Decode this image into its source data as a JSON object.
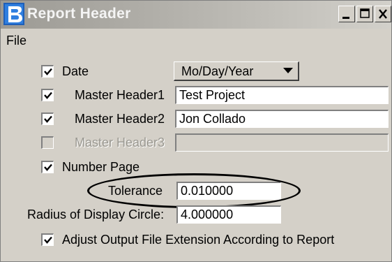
{
  "window": {
    "title": "Report Header",
    "app_icon": "bentley-b-icon",
    "controls": [
      "minimize-icon",
      "maximize-icon",
      "close-icon"
    ]
  },
  "menu": {
    "file": "File"
  },
  "date": {
    "label": "Date",
    "checked": true,
    "format": "Mo/Day/Year"
  },
  "headers": [
    {
      "label": "Master Header1",
      "checked": true,
      "enabled": true,
      "value": "Test Project"
    },
    {
      "label": "Master Header2",
      "checked": true,
      "enabled": true,
      "value": "Jon Collado"
    },
    {
      "label": "Master Header3",
      "checked": false,
      "enabled": false,
      "value": ""
    }
  ],
  "number_page": {
    "label": "Number Page",
    "checked": true
  },
  "tolerance": {
    "label": "Tolerance",
    "value": "0.010000"
  },
  "radius": {
    "label": "Radius of Display Circle:",
    "value": "4.000000"
  },
  "adjust_ext": {
    "label": "Adjust Output File Extension According to Report",
    "checked": true
  },
  "colors": {
    "window_bg": "#d4d0c8",
    "title_text": "#f4f4f4",
    "disabled_text": "#9a9891"
  }
}
